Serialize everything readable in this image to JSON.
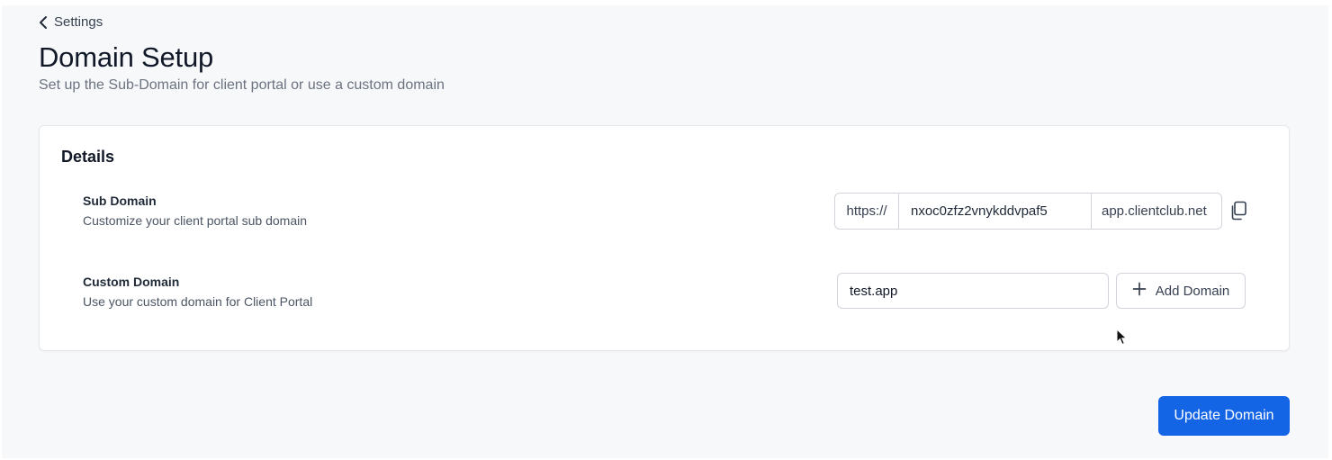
{
  "nav": {
    "back_label": "Settings",
    "back_icon": "chevron-left-icon"
  },
  "header": {
    "title": "Domain Setup",
    "subtitle": "Set up the Sub-Domain for client portal or use a custom domain"
  },
  "details": {
    "title": "Details",
    "sub_domain": {
      "label": "Sub Domain",
      "description": "Customize your client portal sub domain",
      "prefix": "https://",
      "value": "nxoc0zfz2vnykddvpaf5",
      "suffix": "app.clientclub.net",
      "copy_icon": "copy-icon"
    },
    "custom_domain": {
      "label": "Custom Domain",
      "description": "Use your custom domain for Client Portal",
      "value": "test.app",
      "add_label": "Add Domain",
      "add_icon": "plus-icon"
    }
  },
  "footer": {
    "update_label": "Update Domain",
    "accent_color": "#1464e6"
  }
}
